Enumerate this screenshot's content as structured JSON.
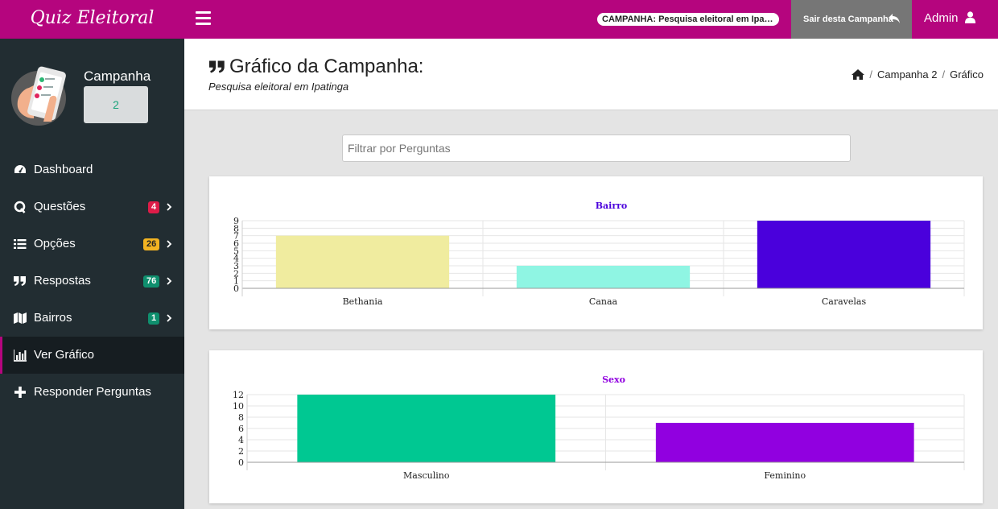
{
  "app": {
    "brand": "Quiz Eleitoral",
    "campaign_pill": "CAMPANHA: Pesquisa eleitoral em Ipatinga...",
    "exit_label": "Sair desta Campanha",
    "user_label": "Admin"
  },
  "sidebar": {
    "campaign_label": "Campanha",
    "campaign_value": "2",
    "items": [
      {
        "label": "Dashboard",
        "icon": "dashboard-icon"
      },
      {
        "label": "Questões",
        "icon": "q-icon",
        "badge": "4",
        "badge_color": "#dd1c48"
      },
      {
        "label": "Opções",
        "icon": "list-icon",
        "badge": "26",
        "badge_color": "#f2b322"
      },
      {
        "label": "Respostas",
        "icon": "quote-icon",
        "badge": "76",
        "badge_color": "#0f8f6e"
      },
      {
        "label": "Bairros",
        "icon": "map-icon",
        "badge": "1",
        "badge_color": "#0f8f6e"
      },
      {
        "label": "Ver Gráfico",
        "icon": "bar-chart-icon",
        "active": true
      },
      {
        "label": "Responder Perguntas",
        "icon": "plus-icon"
      }
    ]
  },
  "header": {
    "title": "Gráfico da Campanha:",
    "subtitle": "Pesquisa eleitoral em Ipatinga",
    "breadcrumb": [
      "Campanha 2",
      "Gráfico"
    ]
  },
  "filter": {
    "placeholder": "Filtrar por Perguntas"
  },
  "chart_data": [
    {
      "type": "bar",
      "title": "Bairro",
      "title_color": "#4a00dc",
      "categories": [
        "Bethania",
        "Canaa",
        "Caravelas"
      ],
      "values": [
        7,
        3,
        9
      ],
      "colors": [
        "#f0ec9f",
        "#8ff5e3",
        "#4a00dc"
      ],
      "ylim": [
        0,
        9
      ],
      "yticks": [
        0,
        1,
        2,
        3,
        4,
        5,
        6,
        7,
        8,
        9
      ],
      "grid": true,
      "xlabel": "",
      "ylabel": ""
    },
    {
      "type": "bar",
      "title": "Sexo",
      "title_color": "#9100e0",
      "categories": [
        "Masculino",
        "Feminino"
      ],
      "values": [
        12,
        7
      ],
      "colors": [
        "#00c892",
        "#9100e0"
      ],
      "ylim": [
        0,
        12
      ],
      "yticks": [
        0,
        2,
        4,
        6,
        8,
        10,
        12
      ],
      "grid": true,
      "xlabel": "",
      "ylabel": ""
    }
  ]
}
